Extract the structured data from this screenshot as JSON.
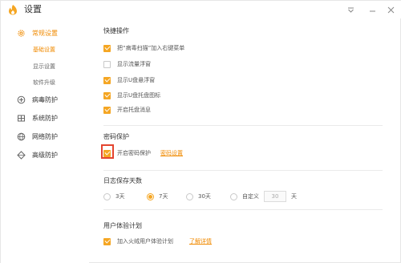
{
  "window": {
    "title": "设置"
  },
  "sidebar": {
    "groups": [
      {
        "label": "常规设置",
        "icon": "gear-icon",
        "active": true
      },
      {
        "label": "病毒防护",
        "icon": "plus-circle-icon"
      },
      {
        "label": "系统防护",
        "icon": "cross-box-icon"
      },
      {
        "label": "网络防护",
        "icon": "globe-icon"
      },
      {
        "label": "高级防护",
        "icon": "diamond-icon"
      }
    ],
    "subitems": [
      {
        "label": "基础设置",
        "active": true
      },
      {
        "label": "显示设置"
      },
      {
        "label": "软件升级"
      }
    ]
  },
  "shortcuts": {
    "title": "快捷操作",
    "items": [
      {
        "label": "把“病毒扫描”加入右键菜单",
        "checked": true
      },
      {
        "label": "显示流量浮窗",
        "checked": false
      },
      {
        "label": "显示U盘悬浮窗",
        "checked": true
      },
      {
        "label": "显示U盘托盘图标",
        "checked": true
      },
      {
        "label": "开启托盘消息",
        "checked": true
      }
    ]
  },
  "password": {
    "title": "密码保护",
    "checkbox_label": "开启密码保护",
    "checked": true,
    "link": "密码设置"
  },
  "log": {
    "title": "日志保存天数",
    "options": [
      "3天",
      "7天",
      "30天",
      "自定义"
    ],
    "selected": "7天",
    "custom_value": "30",
    "unit": "天"
  },
  "ux": {
    "title": "用户体验计划",
    "checkbox_label": "加入火绒用户体验计划",
    "checked": true,
    "link": "了解详情"
  },
  "colors": {
    "accent": "#f08a00",
    "checkbox": "#f5a623",
    "highlight": "#e4442f"
  }
}
